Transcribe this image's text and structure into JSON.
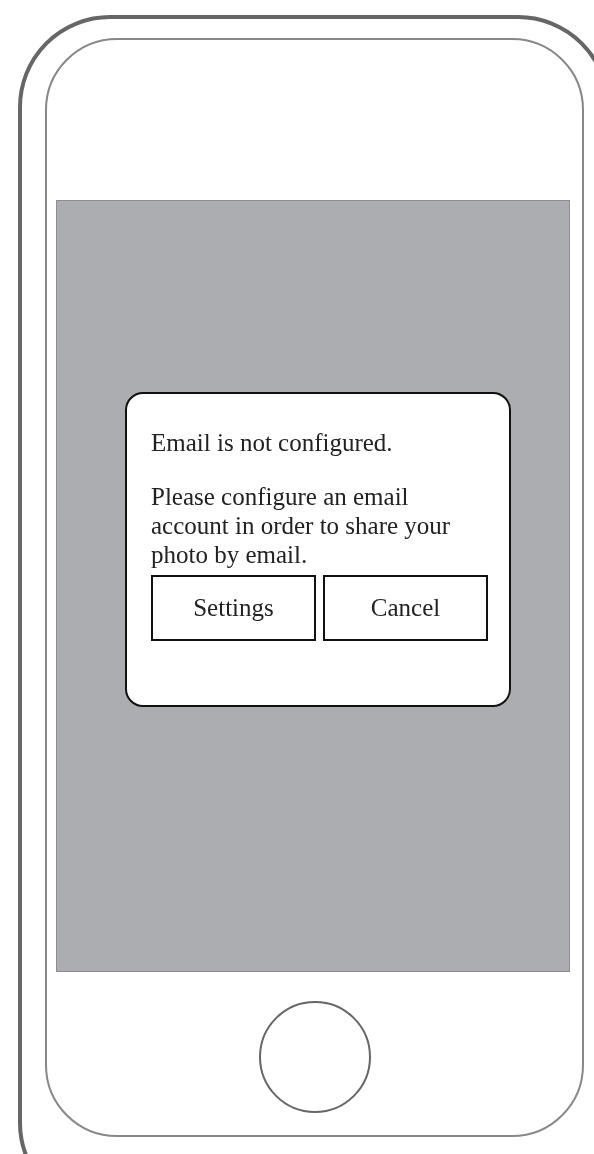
{
  "dialog": {
    "title": "Email is not configured.",
    "message": "Please configure an email account in order to share your photo by email.",
    "buttons": [
      "Settings",
      "Cancel"
    ]
  }
}
